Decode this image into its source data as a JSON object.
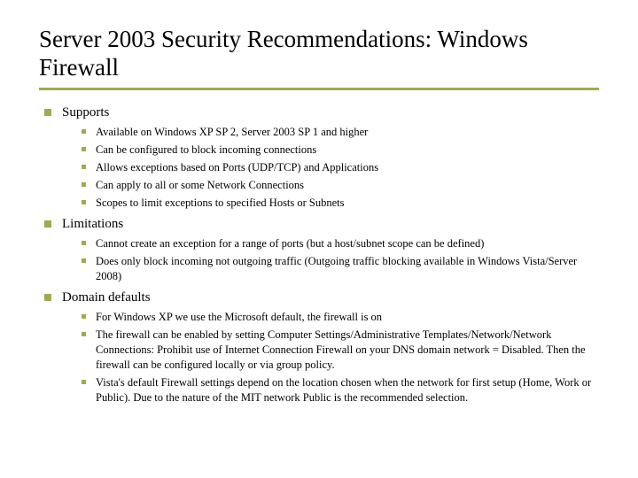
{
  "title": "Server 2003 Security Recommendations: Windows Firewall",
  "sections": [
    {
      "heading": "Supports",
      "items": [
        "Available on Windows XP SP 2, Server 2003 SP 1 and higher",
        "Can be configured to block incoming connections",
        "Allows exceptions based on Ports (UDP/TCP) and Applications",
        "Can apply to all or some Network Connections",
        "Scopes to limit exceptions to specified Hosts or Subnets"
      ]
    },
    {
      "heading": "Limitations",
      "items": [
        "Cannot create an exception for a range of ports (but a host/subnet scope can be defined)",
        "Does only block incoming not outgoing traffic (Outgoing traffic blocking available in Windows Vista/Server 2008)"
      ]
    },
    {
      "heading": "Domain defaults",
      "items": [
        "For Windows XP we use the Microsoft default, the firewall is on",
        "The firewall can be enabled by setting Computer Settings/Administrative Templates/Network/Network Connections: Prohibit use of Internet Connection Firewall on your DNS domain network = Disabled. Then the firewall can be configured locally or via group policy.",
        "Vista's default Firewall settings depend on the location chosen when the network for first setup (Home, Work or Public). Due to the nature of the MIT network Public is the recommended selection."
      ]
    }
  ]
}
